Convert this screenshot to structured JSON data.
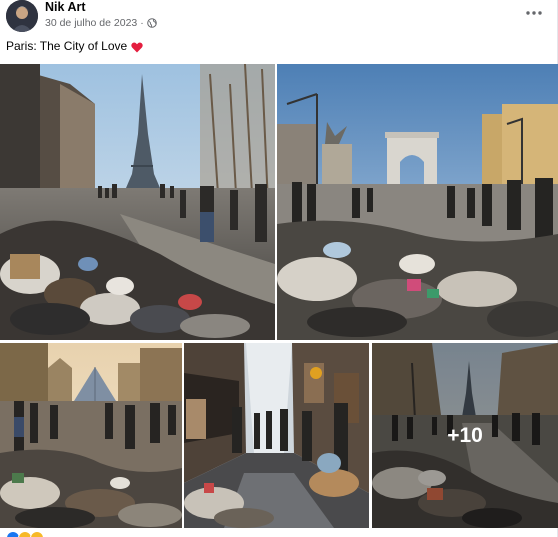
{
  "post": {
    "author_name": "Nik Art",
    "date": "30 de julho de 2023",
    "privacy_icon": "globe-icon",
    "more_icon": "more-options-icon",
    "caption_text": "Paris: The City of Love",
    "caption_emoji": "heart-icon",
    "heart_color": "#e41e3f"
  },
  "photos": {
    "extra_count_label": "+10"
  },
  "colors": {
    "meta_text": "#65676b",
    "reaction_like": "#1877f2",
    "reaction_haha": "#f7b928"
  }
}
